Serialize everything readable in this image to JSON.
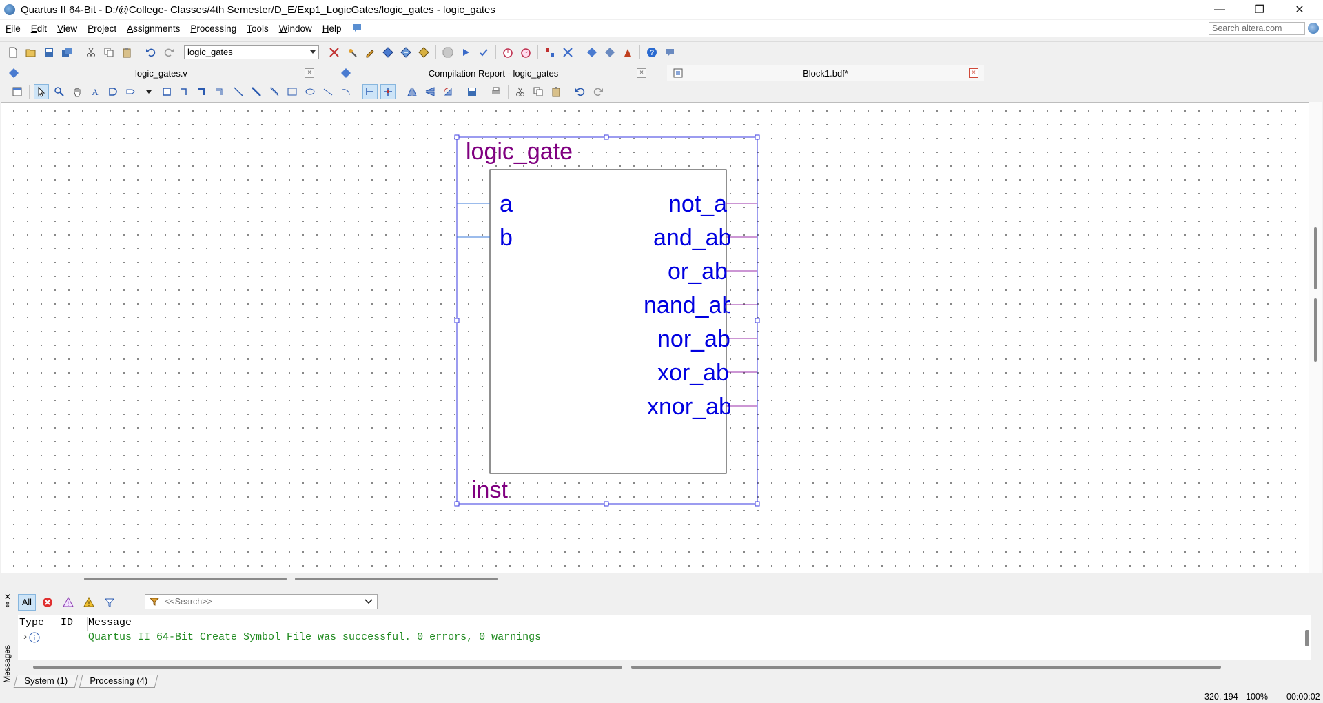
{
  "window": {
    "title": "Quartus II 64-Bit - D:/@College- Classes/4th Semester/D_E/Exp1_LogicGates/logic_gates - logic_gates",
    "minimize": "—",
    "restore": "❐",
    "close": "✕"
  },
  "menu": {
    "items": [
      {
        "label": "File",
        "ul": "F",
        "rest": "ile"
      },
      {
        "label": "Edit",
        "ul": "E",
        "rest": "dit"
      },
      {
        "label": "View",
        "ul": "V",
        "rest": "iew"
      },
      {
        "label": "Project",
        "ul": "P",
        "rest": "roject"
      },
      {
        "label": "Assignments",
        "ul": "A",
        "rest": "ssignments"
      },
      {
        "label": "Processing",
        "ul": "P",
        "rest": "rocessing"
      },
      {
        "label": "Tools",
        "ul": "T",
        "rest": "ools"
      },
      {
        "label": "Window",
        "ul": "W",
        "rest": "indow"
      },
      {
        "label": "Help",
        "ul": "H",
        "rest": "elp"
      }
    ],
    "search_placeholder": "Search altera.com"
  },
  "toolbar": {
    "project_select": "logic_gates"
  },
  "tabs": [
    {
      "label": "logic_gates.v",
      "active": false
    },
    {
      "label": "Compilation Report - logic_gates",
      "active": false
    },
    {
      "label": "Block1.bdf*",
      "active": true
    }
  ],
  "symbol": {
    "title": "logic_gate",
    "instance": "inst",
    "inputs": [
      "a",
      "b"
    ],
    "outputs": [
      "not_a",
      "and_ab",
      "or_ab",
      "nand_ab",
      "nor_ab",
      "xor_ab",
      "xnor_ab"
    ],
    "colors": {
      "pin_text": "#0000e0",
      "title_text": "#800080",
      "frame": "#3a3ae0"
    }
  },
  "messages": {
    "filter_all": "All",
    "search_placeholder": "<<Search>>",
    "columns": [
      "Type",
      "ID",
      "Message"
    ],
    "rows": [
      {
        "type_icon": "info-icon",
        "id": "",
        "text": "Quartus II 64-Bit Create Symbol File was successful. 0 errors, 0 warnings"
      }
    ],
    "side_label": "Messages",
    "tabs": [
      "System (1)",
      "Processing (4)"
    ]
  },
  "status": {
    "coords": "320, 194",
    "zoom": "100%",
    "time": "00:00:02"
  }
}
